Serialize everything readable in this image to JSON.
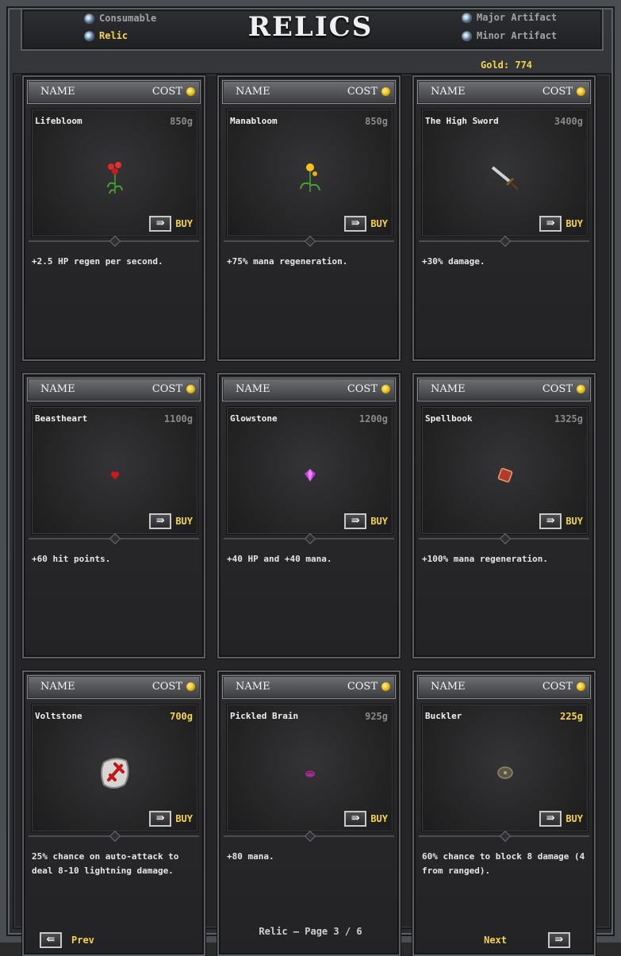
{
  "header": {
    "title": "RELICS",
    "categories": {
      "consumable": "Consumable",
      "relic": "Relic",
      "major_artifact": "Major Artifact",
      "minor_artifact": "Minor Artifact"
    },
    "active_category": "Relic"
  },
  "gold": "Gold: 774",
  "card_header": {
    "name": "NAME",
    "cost": "COST"
  },
  "buy_label": "BUY",
  "items": [
    {
      "name": "Lifebloom",
      "price": "850g",
      "affordable": false,
      "desc": "+2.5 HP regen per second.",
      "icon": "red-flower-icon"
    },
    {
      "name": "Manabloom",
      "price": "850g",
      "affordable": false,
      "desc": "+75% mana regeneration.",
      "icon": "yellow-flower-icon"
    },
    {
      "name": "The High Sword",
      "price": "3400g",
      "affordable": false,
      "desc": "+30% damage.",
      "icon": "sword-icon"
    },
    {
      "name": "Beastheart",
      "price": "1100g",
      "affordable": false,
      "desc": "+60 hit points.",
      "icon": "heart-icon"
    },
    {
      "name": "Glowstone",
      "price": "1200g",
      "affordable": false,
      "desc": "+40 HP and +40 mana.",
      "icon": "gem-icon"
    },
    {
      "name": "Spellbook",
      "price": "1325g",
      "affordable": false,
      "desc": "+100% mana regeneration.",
      "icon": "book-icon"
    },
    {
      "name": "Voltstone",
      "price": "700g",
      "affordable": true,
      "desc": "25% chance on auto-attack to deal 8-10 lightning damage.",
      "icon": "rune-stone-icon"
    },
    {
      "name": "Pickled Brain",
      "price": "925g",
      "affordable": false,
      "desc": "+80 mana.",
      "icon": "brain-icon"
    },
    {
      "name": "Buckler",
      "price": "225g",
      "affordable": true,
      "desc": "60% chance to block 8 damage (4 from ranged).",
      "icon": "shield-icon"
    }
  ],
  "nav": {
    "prev": "Prev",
    "next": "Next"
  },
  "page": {
    "category": "Relic",
    "separator": "—",
    "label": "Page",
    "current": "3",
    "slash": "/",
    "total": "6"
  },
  "colors": {
    "gold": "#f5d44a",
    "unaffordable": "#8a8a8a"
  }
}
